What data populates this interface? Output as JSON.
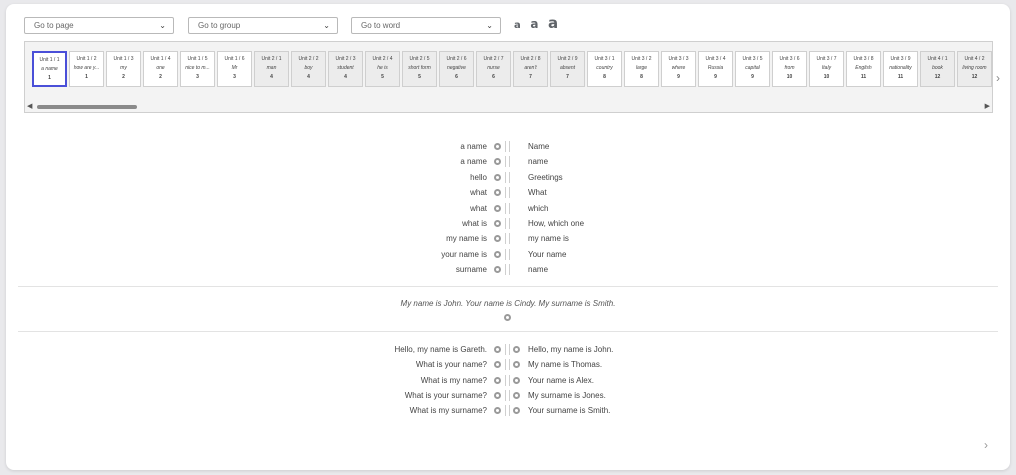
{
  "controls": {
    "go_to_page": "Go to page",
    "go_to_group": "Go to group",
    "go_to_word": "Go to word",
    "font_sizes": [
      "a",
      "a",
      "a"
    ]
  },
  "tiles": [
    {
      "unit": "Unit 1 / 1",
      "word": "a name",
      "num": "1",
      "active": true,
      "dim": false
    },
    {
      "unit": "Unit 1 / 2",
      "word": "how are y...",
      "num": "1",
      "active": false,
      "dim": false
    },
    {
      "unit": "Unit 1 / 3",
      "word": "my",
      "num": "2",
      "active": false,
      "dim": false
    },
    {
      "unit": "Unit 1 / 4",
      "word": "one",
      "num": "2",
      "active": false,
      "dim": false
    },
    {
      "unit": "Unit 1 / 5",
      "word": "nice to m...",
      "num": "3",
      "active": false,
      "dim": false
    },
    {
      "unit": "Unit 1 / 6",
      "word": "Mr",
      "num": "3",
      "active": false,
      "dim": false
    },
    {
      "unit": "Unit 2 / 1",
      "word": "man",
      "num": "4",
      "active": false,
      "dim": true
    },
    {
      "unit": "Unit 2 / 2",
      "word": "boy",
      "num": "4",
      "active": false,
      "dim": true
    },
    {
      "unit": "Unit 2 / 3",
      "word": "student",
      "num": "4",
      "active": false,
      "dim": true
    },
    {
      "unit": "Unit 2 / 4",
      "word": "he is",
      "num": "5",
      "active": false,
      "dim": true
    },
    {
      "unit": "Unit 2 / 5",
      "word": "short form",
      "num": "5",
      "active": false,
      "dim": true
    },
    {
      "unit": "Unit 2 / 6",
      "word": "negative",
      "num": "6",
      "active": false,
      "dim": true
    },
    {
      "unit": "Unit 2 / 7",
      "word": "nurse",
      "num": "6",
      "active": false,
      "dim": true
    },
    {
      "unit": "Unit 2 / 8",
      "word": "aren't",
      "num": "7",
      "active": false,
      "dim": true
    },
    {
      "unit": "Unit 2 / 9",
      "word": "absent",
      "num": "7",
      "active": false,
      "dim": true
    },
    {
      "unit": "Unit 3 / 1",
      "word": "country",
      "num": "8",
      "active": false,
      "dim": false
    },
    {
      "unit": "Unit 3 / 2",
      "word": "large",
      "num": "8",
      "active": false,
      "dim": false
    },
    {
      "unit": "Unit 3 / 3",
      "word": "where",
      "num": "9",
      "active": false,
      "dim": false
    },
    {
      "unit": "Unit 3 / 4",
      "word": "Russia",
      "num": "9",
      "active": false,
      "dim": false
    },
    {
      "unit": "Unit 3 / 5",
      "word": "capital",
      "num": "9",
      "active": false,
      "dim": false
    },
    {
      "unit": "Unit 3 / 6",
      "word": "from",
      "num": "10",
      "active": false,
      "dim": false
    },
    {
      "unit": "Unit 3 / 7",
      "word": "Italy",
      "num": "10",
      "active": false,
      "dim": false
    },
    {
      "unit": "Unit 3 / 8",
      "word": "English",
      "num": "11",
      "active": false,
      "dim": false
    },
    {
      "unit": "Unit 3 / 9",
      "word": "nationality",
      "num": "11",
      "active": false,
      "dim": false
    },
    {
      "unit": "Unit 4 / 1",
      "word": "book",
      "num": "12",
      "active": false,
      "dim": true
    },
    {
      "unit": "Unit 4 / 2",
      "word": "living room",
      "num": "12",
      "active": false,
      "dim": true
    }
  ],
  "vocab": [
    {
      "left": "a name",
      "right": "Name"
    },
    {
      "left": "a name",
      "right": "name"
    },
    {
      "left": "hello",
      "right": "Greetings"
    },
    {
      "left": "what",
      "right": "What"
    },
    {
      "left": "what",
      "right": "which"
    },
    {
      "left": "what is",
      "right": "How, which one"
    },
    {
      "left": "my name is",
      "right": "my name is"
    },
    {
      "left": "your name is",
      "right": "Your name"
    },
    {
      "left": "surname",
      "right": "name"
    }
  ],
  "sentence": "My name is John. Your name is Cindy. My surname is Smith.",
  "dialog": [
    {
      "left": "Hello, my name is Gareth.",
      "right": "Hello, my name is John."
    },
    {
      "left": "What is your name?",
      "right": "My name is Thomas."
    },
    {
      "left": "What is my name?",
      "right": "Your name is Alex."
    },
    {
      "left": "What is your surname?",
      "right": "My surname is Jones."
    },
    {
      "left": "What is my surname?",
      "right": "Your surname is Smith."
    }
  ]
}
